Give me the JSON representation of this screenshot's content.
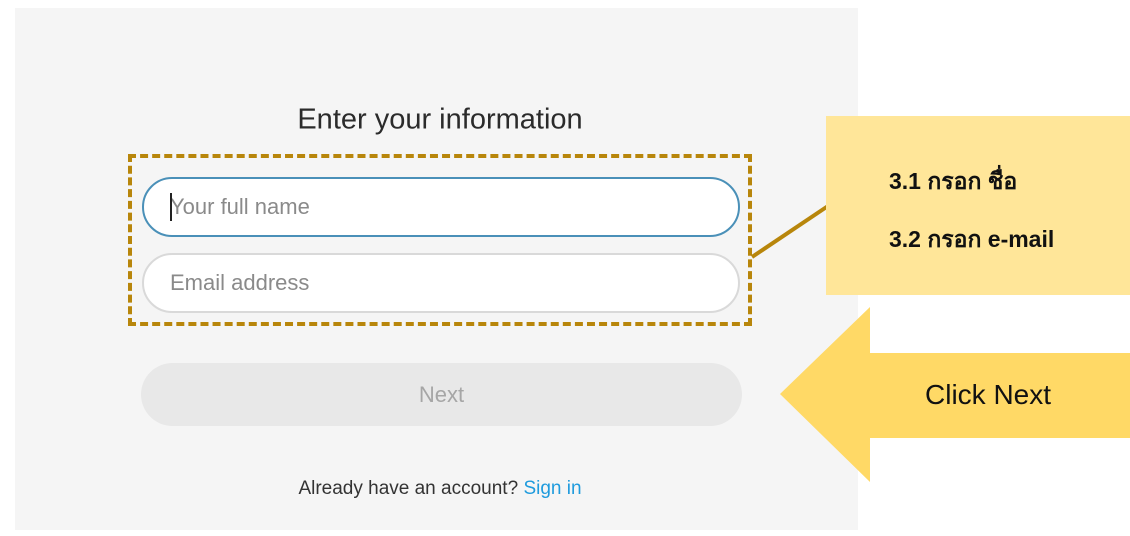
{
  "form": {
    "title": "Enter your information",
    "name_placeholder": "Your full name",
    "name_value": "",
    "email_placeholder": "Email address",
    "email_value": "",
    "next_label": "Next",
    "signin_prompt": "Already have an account?",
    "signin_link": "Sign in"
  },
  "callout": {
    "line1": "3.1 กรอก ชื่อ",
    "line2": "3.2 กรอก e-mail",
    "color": "#ffe699"
  },
  "arrow": {
    "label": "Click Next",
    "color": "#ffd966"
  },
  "colors": {
    "highlight_border": "#b8860b",
    "focused_field_border": "#4a90b8",
    "link": "#1f9bdd",
    "next_button_bg": "#e8e8e8"
  }
}
